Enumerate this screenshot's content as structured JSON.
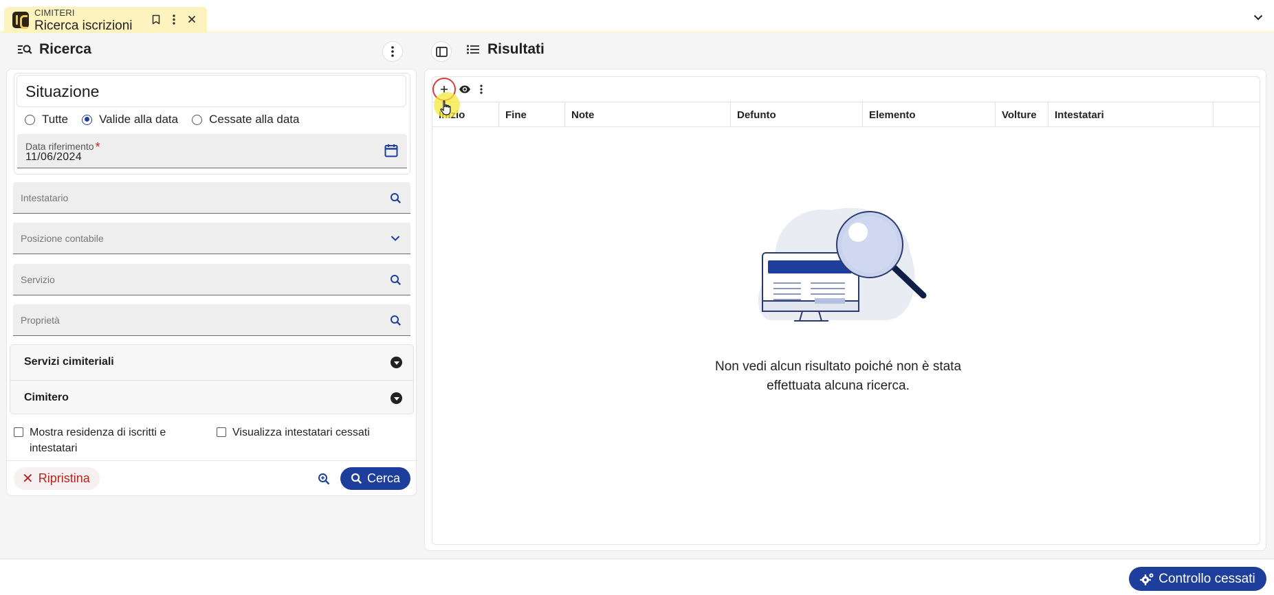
{
  "app_tab": {
    "module": "CIMITERI",
    "title": "Ricerca iscrizioni"
  },
  "search_panel": {
    "title": "Ricerca",
    "situazione": {
      "title": "Situazione",
      "radios": [
        {
          "label": "Tutte",
          "checked": false
        },
        {
          "label": "Valide alla data",
          "checked": true
        },
        {
          "label": "Cessate alla data",
          "checked": false
        }
      ],
      "date_field": {
        "label": "Data riferimento",
        "required_mark": "*",
        "value": "11/06/2024"
      }
    },
    "fields": {
      "intestatario": "Intestatario",
      "posizione_contabile": "Posizione contabile",
      "servizio": "Servizio",
      "proprieta": "Proprietà"
    },
    "accordion": [
      {
        "label": "Servizi cimiteriali"
      },
      {
        "label": "Cimitero"
      }
    ],
    "checkboxes": {
      "mostra_residenza": "Mostra residenza di iscritti e intestatari",
      "visualizza_cessati": "Visualizza intestatari cessati"
    },
    "buttons": {
      "ripristina": "Ripristina",
      "cerca": "Cerca"
    }
  },
  "results_panel": {
    "title": "Risultati",
    "columns": [
      "Inizio",
      "Fine",
      "Note",
      "Defunto",
      "Elemento",
      "Volture",
      "Intestatari"
    ],
    "empty_message_line1": "Non vedi alcun risultato poiché non è stata",
    "empty_message_line2": "effettuata alcuna ricerca."
  },
  "footer": {
    "controllo_cessati": "Controllo cessati"
  },
  "colors": {
    "primary": "#1d3e9a",
    "tab_bg": "#fdf3bf",
    "danger": "#b3261e"
  }
}
